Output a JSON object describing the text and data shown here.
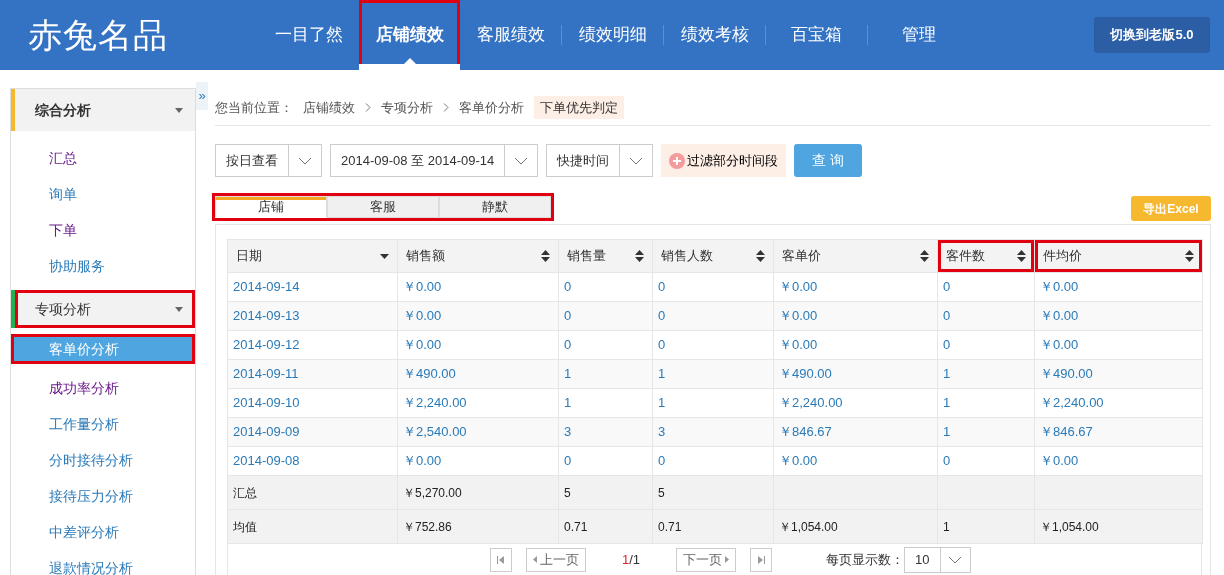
{
  "header": {
    "logo": "赤兔名品",
    "nav": [
      {
        "label": "一目了然",
        "selected": false,
        "highlighted": false
      },
      {
        "label": "店铺绩效",
        "selected": true,
        "highlighted": true
      },
      {
        "label": "客服绩效",
        "selected": false,
        "highlighted": false
      },
      {
        "label": "绩效明细",
        "selected": false,
        "highlighted": false
      },
      {
        "label": "绩效考核",
        "selected": false,
        "highlighted": false
      },
      {
        "label": "百宝箱",
        "selected": false,
        "highlighted": false
      },
      {
        "label": "管理",
        "selected": false,
        "highlighted": false
      }
    ],
    "switch_button": "切换到老版5.0"
  },
  "sidebar": {
    "collapse_toggle": "»",
    "groups": [
      {
        "title": "综合分析",
        "color": "#f5b82e",
        "highlighted": false,
        "items": [
          {
            "label": "汇总",
            "selected": false,
            "visited": true,
            "highlighted": false
          },
          {
            "label": "询单",
            "selected": false,
            "visited": false,
            "highlighted": false
          },
          {
            "label": "下单",
            "selected": false,
            "visited": true,
            "highlighted": false
          },
          {
            "label": "协助服务",
            "selected": false,
            "visited": false,
            "highlighted": false
          }
        ]
      },
      {
        "title": "专项分析",
        "color": "#22b14c",
        "highlighted": true,
        "items": [
          {
            "label": "客单价分析",
            "selected": true,
            "visited": false,
            "highlighted": true
          },
          {
            "label": "成功率分析",
            "selected": false,
            "visited": true,
            "highlighted": false
          },
          {
            "label": "工作量分析",
            "selected": false,
            "visited": false,
            "highlighted": false
          },
          {
            "label": "分时接待分析",
            "selected": false,
            "visited": false,
            "highlighted": false
          },
          {
            "label": "接待压力分析",
            "selected": false,
            "visited": false,
            "highlighted": false
          },
          {
            "label": "中差评分析",
            "selected": false,
            "visited": false,
            "highlighted": false
          },
          {
            "label": "退款情况分析",
            "selected": false,
            "visited": false,
            "highlighted": false
          }
        ]
      }
    ]
  },
  "breadcrumb": {
    "label": "您当前位置：",
    "path": [
      "店铺绩效",
      "专项分析",
      "客单价分析"
    ],
    "tag": "下单优先判定"
  },
  "filters": {
    "view_select": "按日查看",
    "date_range": "2014-09-08 至 2014-09-14",
    "quick_time": "快捷时间",
    "exclude_button": "过滤部分时间段",
    "query_button": "查 询"
  },
  "tabs": {
    "highlighted": true,
    "items": [
      {
        "label": "店铺",
        "selected": true
      },
      {
        "label": "客服",
        "selected": false
      },
      {
        "label": "静默",
        "selected": false
      }
    ]
  },
  "export_button": "导出Excel",
  "table": {
    "columns": [
      {
        "label": "日期",
        "sorted": true,
        "highlighted": false
      },
      {
        "label": "销售额",
        "sorted": false,
        "highlighted": false
      },
      {
        "label": "销售量",
        "sorted": false,
        "highlighted": false
      },
      {
        "label": "销售人数",
        "sorted": false,
        "highlighted": false
      },
      {
        "label": "客单价",
        "sorted": false,
        "highlighted": false
      },
      {
        "label": "客件数",
        "sorted": false,
        "highlighted": true
      },
      {
        "label": "件均价",
        "sorted": false,
        "highlighted": true
      }
    ],
    "rows": [
      {
        "kind": "data",
        "cells": [
          "2014-09-14",
          "￥0.00",
          "0",
          "0",
          "￥0.00",
          "0",
          "￥0.00"
        ]
      },
      {
        "kind": "data",
        "cells": [
          "2014-09-13",
          "￥0.00",
          "0",
          "0",
          "￥0.00",
          "0",
          "￥0.00"
        ]
      },
      {
        "kind": "data",
        "cells": [
          "2014-09-12",
          "￥0.00",
          "0",
          "0",
          "￥0.00",
          "0",
          "￥0.00"
        ]
      },
      {
        "kind": "data",
        "cells": [
          "2014-09-11",
          "￥490.00",
          "1",
          "1",
          "￥490.00",
          "1",
          "￥490.00"
        ]
      },
      {
        "kind": "data",
        "cells": [
          "2014-09-10",
          "￥2,240.00",
          "1",
          "1",
          "￥2,240.00",
          "1",
          "￥2,240.00"
        ]
      },
      {
        "kind": "data",
        "cells": [
          "2014-09-09",
          "￥2,540.00",
          "3",
          "3",
          "￥846.67",
          "1",
          "￥846.67"
        ]
      },
      {
        "kind": "data",
        "cells": [
          "2014-09-08",
          "￥0.00",
          "0",
          "0",
          "￥0.00",
          "0",
          "￥0.00"
        ]
      },
      {
        "kind": "summary",
        "cells": [
          "汇总",
          "￥5,270.00",
          "5",
          "5"
        ]
      },
      {
        "kind": "summary",
        "cells": [
          "均值",
          "￥752.86",
          "0.71",
          "0.71",
          "￥1,054.00",
          "1",
          "￥1,054.00"
        ]
      }
    ]
  },
  "pagination": {
    "prev": "上一页",
    "current": "1",
    "total": "/1",
    "next": "下一页",
    "page_size_label": "每页显示数：",
    "page_size": "10"
  }
}
